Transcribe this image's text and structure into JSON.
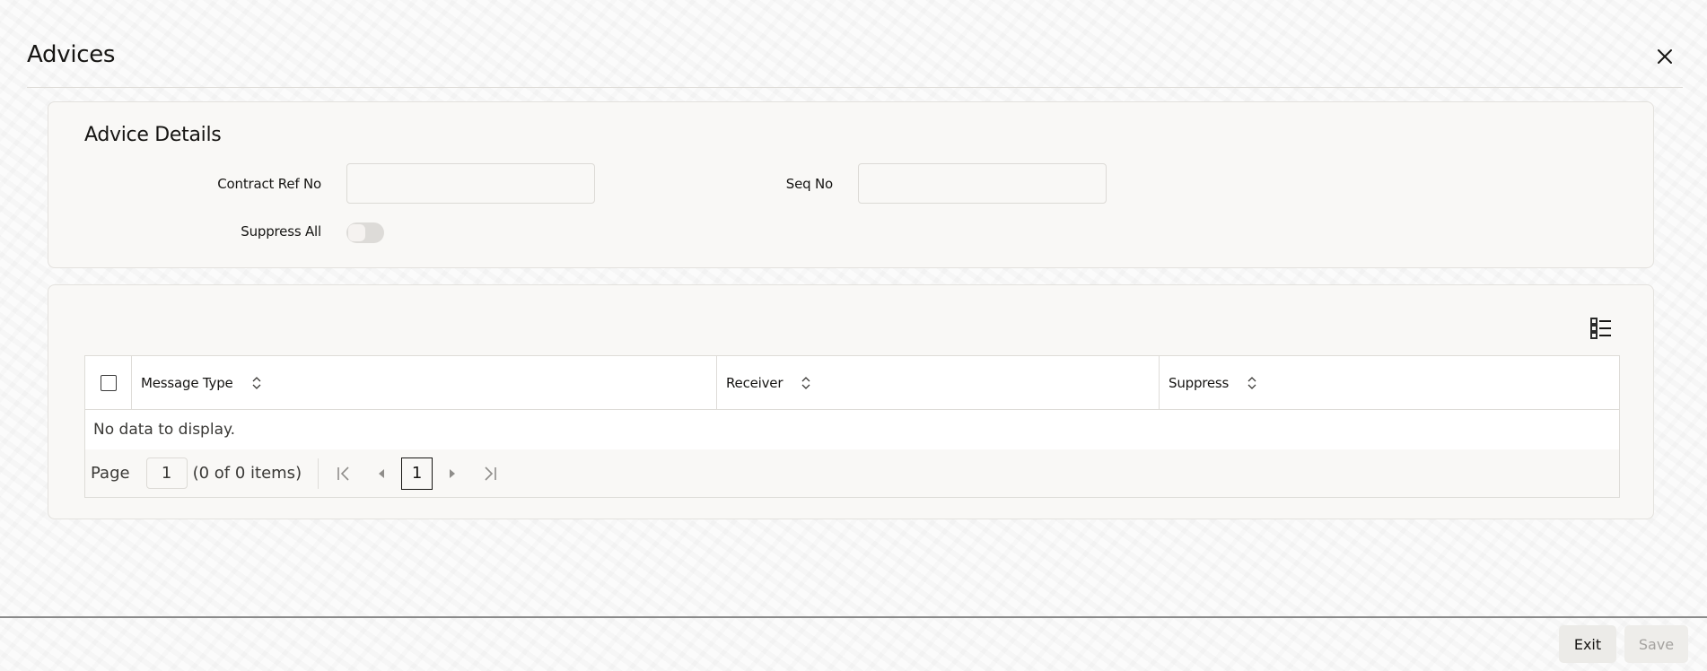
{
  "window": {
    "title": "Advices",
    "close_icon": "close-icon"
  },
  "advice_details": {
    "section_title": "Advice Details",
    "contract_ref_no": {
      "label": "Contract Ref No",
      "value": "",
      "placeholder": ""
    },
    "seq_no": {
      "label": "Seq No",
      "value": "",
      "placeholder": ""
    },
    "suppress_all": {
      "label": "Suppress All",
      "checked": false
    }
  },
  "advices_table": {
    "column_manager_icon": "list-settings-icon",
    "columns": [
      {
        "label": "Message Type",
        "sortable": true
      },
      {
        "label": "Receiver",
        "sortable": true
      },
      {
        "label": "Suppress",
        "sortable": true
      }
    ],
    "select_all_checked": false,
    "rows": [],
    "empty_message": "No data to display.",
    "pagination": {
      "page_label": "Page",
      "page_value": "1",
      "items_summary": "(0 of 0 items)",
      "current_page": "1",
      "first_icon": "first-page-icon",
      "prev_icon": "previous-page-icon",
      "next_icon": "next-page-icon",
      "last_icon": "last-page-icon"
    }
  },
  "footer": {
    "exit_label": "Exit",
    "save_label": "Save",
    "save_enabled": false
  }
}
